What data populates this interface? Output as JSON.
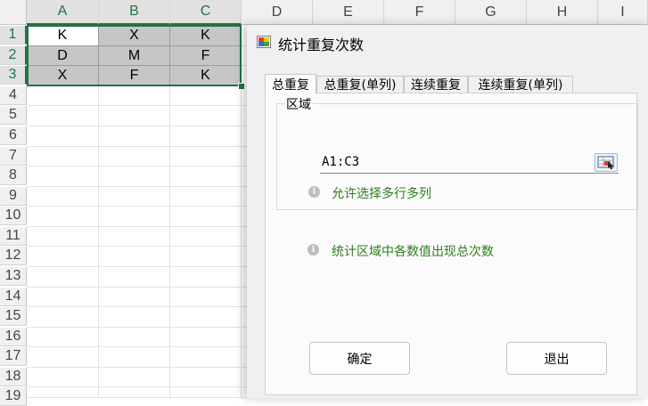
{
  "sheet": {
    "columns": [
      "A",
      "B",
      "C",
      "D",
      "E",
      "F",
      "G",
      "H",
      "I"
    ],
    "rows": [
      "1",
      "2",
      "3",
      "4",
      "5",
      "6",
      "7",
      "8",
      "9",
      "10",
      "11",
      "12",
      "13",
      "14",
      "15",
      "16",
      "17",
      "18",
      "19"
    ],
    "cells": [
      [
        "K",
        "X",
        "K"
      ],
      [
        "D",
        "M",
        "F"
      ],
      [
        "X",
        "F",
        "K"
      ]
    ],
    "selection_color": "#217346"
  },
  "dialog": {
    "title": "统计重复次数",
    "tabs": [
      "总重复",
      "总重复(单列)",
      "连续重复",
      "连续重复(单列)"
    ],
    "active_tab": 0,
    "group_label": "区域",
    "range_value": "A1:C3",
    "hint_multi": "允许选择多行多列",
    "hint_desc": "统计区域中各数值出现总次数",
    "ok_label": "确定",
    "exit_label": "退出",
    "info_icon": "i",
    "hint_color": "#2f7d1f"
  }
}
